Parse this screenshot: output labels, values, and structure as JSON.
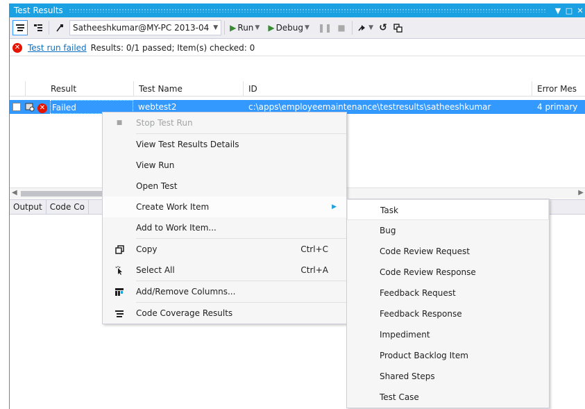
{
  "window": {
    "title": "Test Results",
    "controls": [
      "▼",
      "□",
      "✕"
    ]
  },
  "toolbar": {
    "run_selector": "Satheeshkumar@MY-PC 2013-04",
    "run_label": "Run",
    "debug_label": "Debug",
    "icons": [
      "group-by-icon",
      "details-icon",
      "import-icon",
      "run-icon",
      "debug-icon",
      "pause-icon",
      "stop-icon",
      "export-icon",
      "refresh-icon",
      "copy-icon"
    ]
  },
  "status": {
    "link": "Test run failed",
    "summary": "Results: 0/1 passed;  Item(s) checked: 0"
  },
  "grid": {
    "columns": [
      "Result",
      "Test Name",
      "ID",
      "Error Mes"
    ],
    "rows": [
      {
        "result": "Failed",
        "test_name": "webtest2",
        "id": "c:\\apps\\employeemaintenance\\testresults\\satheeshkumar",
        "error": "4 primary"
      }
    ]
  },
  "bottom_tabs": [
    "Output",
    "Code Co"
  ],
  "context_menu": {
    "items": [
      {
        "label": "Stop Test Run",
        "disabled": true
      },
      {
        "label": "View Test Results Details"
      },
      {
        "label": "View Run"
      },
      {
        "label": "Open Test"
      },
      {
        "label": "Create Work Item",
        "submenu": true
      },
      {
        "label": "Add to Work Item..."
      },
      {
        "label": "Copy",
        "shortcut": "Ctrl+C",
        "icon": "copy-icon"
      },
      {
        "label": "Select All",
        "shortcut": "Ctrl+A",
        "icon": "select-all-icon"
      },
      {
        "label": "Add/Remove Columns...",
        "icon": "columns-icon"
      },
      {
        "label": "Code Coverage Results",
        "icon": "coverage-icon"
      }
    ]
  },
  "submenu": {
    "items": [
      "Task",
      "Bug",
      "Code Review Request",
      "Code Review Response",
      "Feedback Request",
      "Feedback Response",
      "Impediment",
      "Product Backlog Item",
      "Shared Steps",
      "Test Case"
    ]
  },
  "colors": {
    "accent": "#1ba1e2",
    "selection": "#3399ff",
    "error": "#e51400",
    "link": "#0e70c0"
  }
}
